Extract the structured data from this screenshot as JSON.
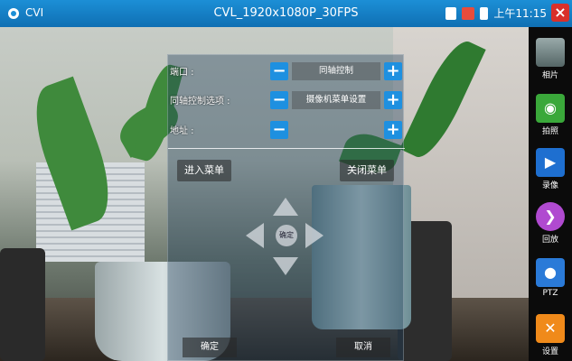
{
  "header": {
    "app_name": "CVI",
    "title": "CVL_1920x1080P_30FPS",
    "time": "上午11:15"
  },
  "dialog": {
    "rows": [
      {
        "label": "端口 :",
        "value": "同轴控制"
      },
      {
        "label": "同轴控制选项 :",
        "value": "摄像机菜单设置"
      },
      {
        "label": "地址 :",
        "value": ""
      }
    ],
    "enter_menu": "进入菜单",
    "close_menu": "关闭菜单",
    "center_ok": "确定",
    "confirm": "确定",
    "cancel": "取消"
  },
  "sidebar": {
    "items": [
      {
        "label": "相片",
        "icon": "photo-album-icon"
      },
      {
        "label": "拍照",
        "icon": "camera-icon"
      },
      {
        "label": "录像",
        "icon": "video-record-icon"
      },
      {
        "label": "回放",
        "icon": "playback-icon"
      },
      {
        "label": "PTZ",
        "icon": "ptz-icon"
      },
      {
        "label": "设置",
        "icon": "settings-tools-icon"
      }
    ]
  },
  "colors": {
    "accent": "#1e90e0",
    "close": "#d9302a"
  }
}
